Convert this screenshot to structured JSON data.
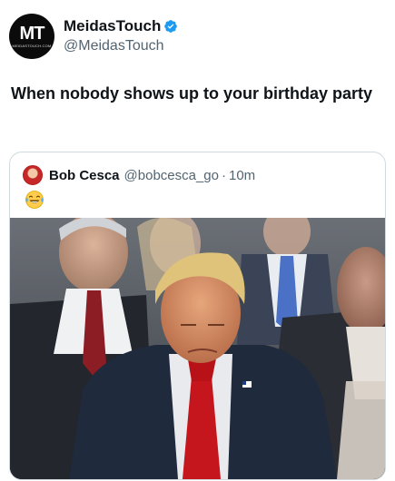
{
  "post": {
    "avatar_text": "MT",
    "avatar_subtext": "MEIDASTOUCH.COM",
    "display_name": "MeidasTouch",
    "handle": "@MeidasTouch",
    "text": "When nobody shows up to your birthday party"
  },
  "quote": {
    "display_name": "Bob Cesca",
    "handle": "@bobcesca_go",
    "separator": "·",
    "time": "10m",
    "emoji": "laughing-tears-emoji"
  },
  "colors": {
    "text": "#0f1419",
    "secondary": "#536471",
    "border": "#cfd9de",
    "verified": "#1d9bf0"
  }
}
